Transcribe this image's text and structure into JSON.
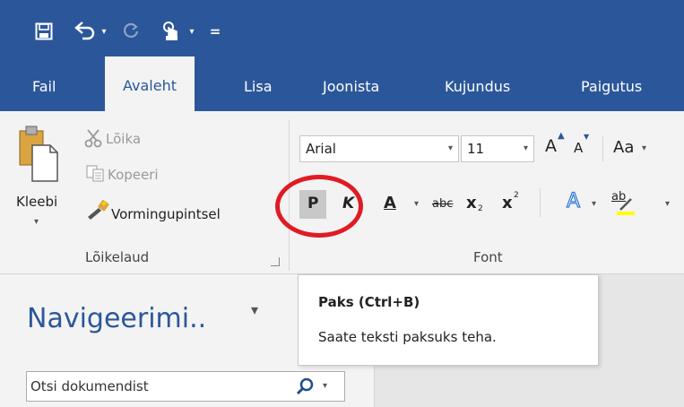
{
  "qat": {
    "save_icon": "save-icon",
    "undo_icon": "undo-icon",
    "redo_icon": "redo-icon",
    "touch_mode_icon": "touch-mode-icon",
    "dropdown_glyph": "▾",
    "customize_glyph": "="
  },
  "tabs": [
    "Fail",
    "Avaleht",
    "Lisa",
    "Joonista",
    "Kujundus",
    "Paigutus"
  ],
  "clipboard": {
    "paste_label": "Kleebi",
    "paste_arrow": "▾",
    "cut_label": "Lõika",
    "copy_label": "Kopeeri",
    "format_painter_label": "Vormingupintsel",
    "group_label": "Lõikelaud"
  },
  "font": {
    "font_name": "Arial",
    "font_size": "11",
    "grow_label": "A",
    "shrink_label": "A",
    "case_label": "Aa",
    "bold_label": "P",
    "italic_label": "K",
    "underline_label": "A",
    "strike_label": "abc",
    "subscript_label": "x",
    "superscript_label": "x",
    "sub_mark": "2",
    "sup_mark": "2",
    "effects_label": "A",
    "highlight_label": "ab",
    "dropdown_glyph": "▾",
    "group_label": "Font"
  },
  "tooltip": {
    "title": "Paks (Ctrl+B)",
    "description": "Saate teksti paksuks teha."
  },
  "navigation": {
    "title": "Navigeerimi..",
    "menu_glyph": "▾",
    "search_placeholder": "Otsi dokumendist",
    "search_dropdown": "▾"
  },
  "colors": {
    "ribbon_blue": "#2b579a",
    "ribbon_bg": "#f3f3f3",
    "annotation_red": "#e01b24",
    "highlight_yellow": "#ffff00"
  }
}
